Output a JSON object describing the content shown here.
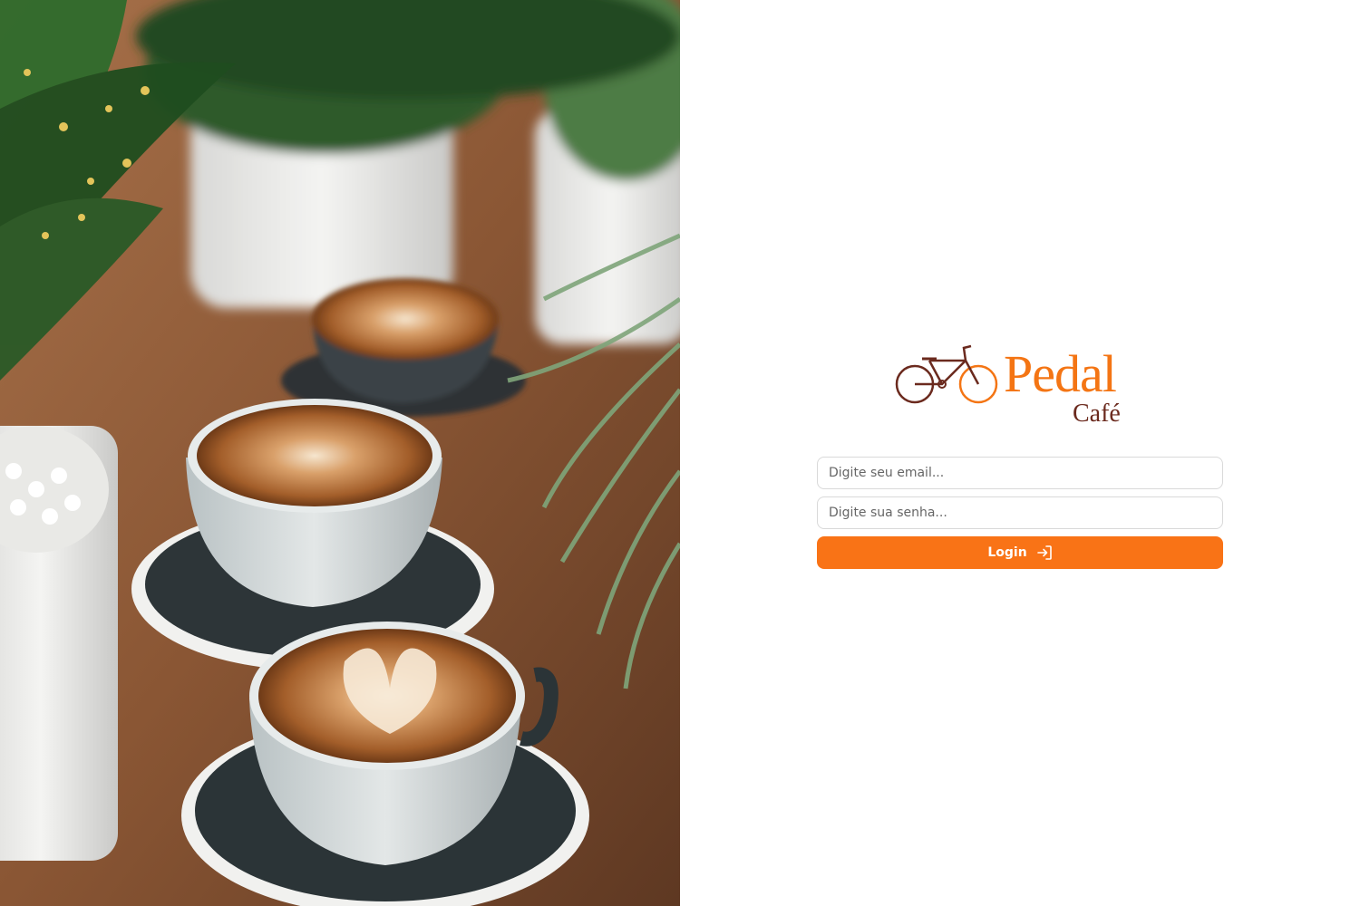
{
  "brand": {
    "name": "Pedal",
    "subtitle": "Café",
    "primary_color": "#f97316",
    "accent_color": "#6b2a1e"
  },
  "hero": {
    "image_icon": "coffee-cups-photo"
  },
  "login_form": {
    "email_placeholder": "Digite seu email...",
    "password_placeholder": "Digite sua senha...",
    "submit_label": "Login",
    "submit_icon": "log-in-icon"
  }
}
